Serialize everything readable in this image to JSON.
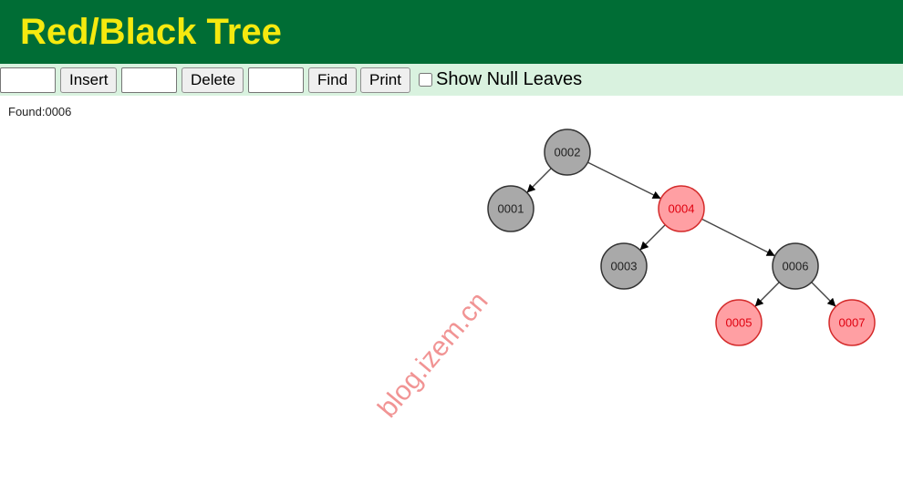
{
  "app": {
    "title": "Red/Black Tree"
  },
  "toolbar": {
    "insert_value": "",
    "insert_label": "Insert",
    "delete_value": "",
    "delete_label": "Delete",
    "find_value": "",
    "find_label": "Find",
    "print_label": "Print",
    "show_null_leaves_label": "Show Null Leaves",
    "show_null_leaves_checked": false
  },
  "status": {
    "text": "Found:0006"
  },
  "watermark": {
    "text": "blog.izem.cn"
  },
  "colors": {
    "header_bg": "#006d35",
    "title_color": "#f5e90f",
    "toolbar_bg": "#d9f2df",
    "black_node_fill": "#a9a9a9",
    "black_node_text": "#222222",
    "red_node_fill": "#ff9fa3",
    "red_node_text": "#e0000f",
    "red_node_stroke": "#d42a2a",
    "edge_color": "#444444"
  },
  "tree": {
    "nodes": [
      {
        "id": "n2",
        "label": "0002",
        "color": "black"
      },
      {
        "id": "n1",
        "label": "0001",
        "color": "black"
      },
      {
        "id": "n4",
        "label": "0004",
        "color": "red"
      },
      {
        "id": "n3",
        "label": "0003",
        "color": "black"
      },
      {
        "id": "n6",
        "label": "0006",
        "color": "black"
      },
      {
        "id": "n5",
        "label": "0005",
        "color": "red"
      },
      {
        "id": "n7",
        "label": "0007",
        "color": "red"
      }
    ],
    "edges": [
      {
        "from": "n2",
        "to": "n1"
      },
      {
        "from": "n2",
        "to": "n4"
      },
      {
        "from": "n4",
        "to": "n3"
      },
      {
        "from": "n4",
        "to": "n6"
      },
      {
        "from": "n6",
        "to": "n5"
      },
      {
        "from": "n6",
        "to": "n7"
      }
    ]
  }
}
